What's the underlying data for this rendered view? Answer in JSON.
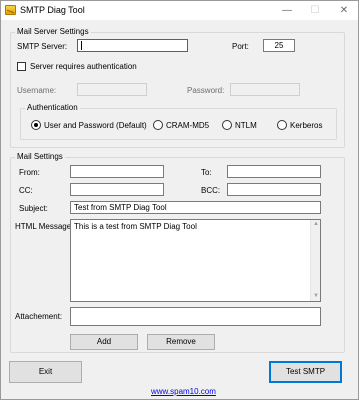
{
  "window": {
    "title": "SMTP Diag Tool",
    "minimize": "—",
    "maximize": "☐",
    "close": "✕"
  },
  "server": {
    "legend": "Mail Server Settings",
    "smtp_label": "SMTP Server:",
    "smtp_value": "",
    "port_label": "Port:",
    "port_value": "25",
    "auth_checkbox_label": "Server requires authentication",
    "auth_required": false,
    "username_label": "Username:",
    "username_value": "",
    "password_label": "Password:",
    "password_value": "",
    "auth": {
      "legend": "Authentication",
      "options": [
        "User and Password (Default)",
        "CRAM-MD5",
        "NTLM",
        "Kerberos"
      ],
      "selected": "User and Password (Default)"
    }
  },
  "mail": {
    "legend": "Mail Settings",
    "from_label": "From:",
    "from_value": "",
    "to_label": "To:",
    "to_value": "",
    "cc_label": "CC:",
    "cc_value": "",
    "bcc_label": "BCC:",
    "bcc_value": "",
    "subject_label": "Subject:",
    "subject_value": "Test from SMTP Diag Tool",
    "html_label": "HTML Message:",
    "html_value": "This is a test from SMTP Diag Tool",
    "attachment_label": "Attachement:",
    "attachment_value": "",
    "add_button": "Add",
    "remove_button": "Remove"
  },
  "footer": {
    "exit_button": "Exit",
    "test_button": "Test SMTP",
    "link": "www.spam10.com"
  }
}
